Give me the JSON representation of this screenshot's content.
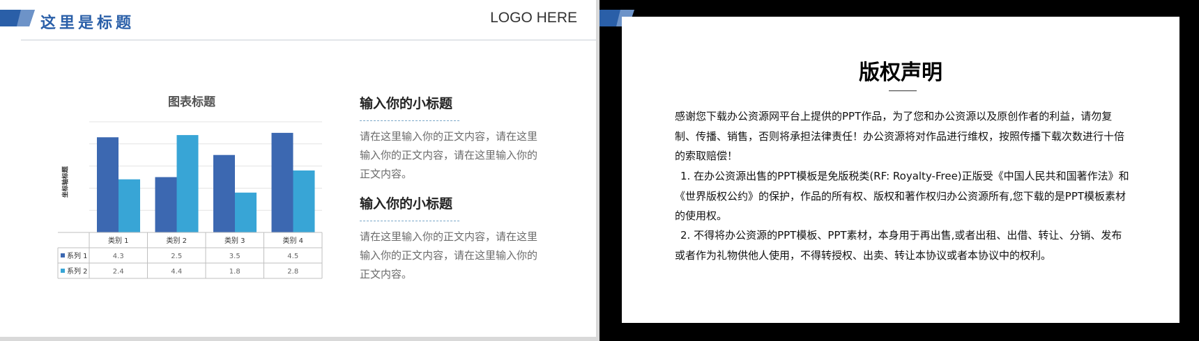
{
  "header": {
    "title": "这里是标题",
    "logo": "LOGO HERE"
  },
  "colors": {
    "accent": "#2a5fa8",
    "series1": "#3c68b1",
    "series2": "#38a5d6"
  },
  "chart_data": {
    "type": "bar",
    "title": "图表标题",
    "ylabel": "坐标轴标题",
    "categories": [
      "类别 1",
      "类别 2",
      "类别 3",
      "类别 4"
    ],
    "series": [
      {
        "name": "系列 1",
        "values": [
          4.3,
          2.5,
          3.5,
          4.5
        ],
        "color": "#3c68b1"
      },
      {
        "name": "系列 2",
        "values": [
          2.4,
          4.4,
          1.8,
          2.8
        ],
        "color": "#38a5d6"
      }
    ],
    "ylim": [
      0,
      5
    ],
    "grid": true,
    "legend": "data-table"
  },
  "sections": [
    {
      "title": "输入你的小标题",
      "body": "请在这里输入你的正文内容，请在这里输入你的正文内容，请在这里输入你的正文内容。"
    },
    {
      "title": "输入你的小标题",
      "body": "请在这里输入你的正文内容，请在这里输入你的正文内容，请在这里输入你的正文内容。"
    }
  ],
  "notice": {
    "title": "版权声明",
    "paragraphs": [
      "感谢您下载办公资源网平台上提供的PPT作品，为了您和办公资源以及原创作者的利益，请勿复制、传播、销售，否则将承担法律责任！办公资源将对作品进行维权，按照传播下载次数进行十倍的索取赔偿！",
      "1. 在办公资源出售的PPT模板是免版税类(RF: Royalty-Free)正版受《中国人民共和国著作法》和《世界版权公约》的保护，作品的所有权、版权和著作权归办公资源所有,您下载的是PPT模板素材的使用权。",
      "2. 不得将办公资源的PPT模板、PPT素材，本身用于再出售,或者出租、出借、转让、分销、发布或者作为礼物供他人使用，不得转授权、出卖、转让本协议或者本协议中的权利。"
    ]
  }
}
